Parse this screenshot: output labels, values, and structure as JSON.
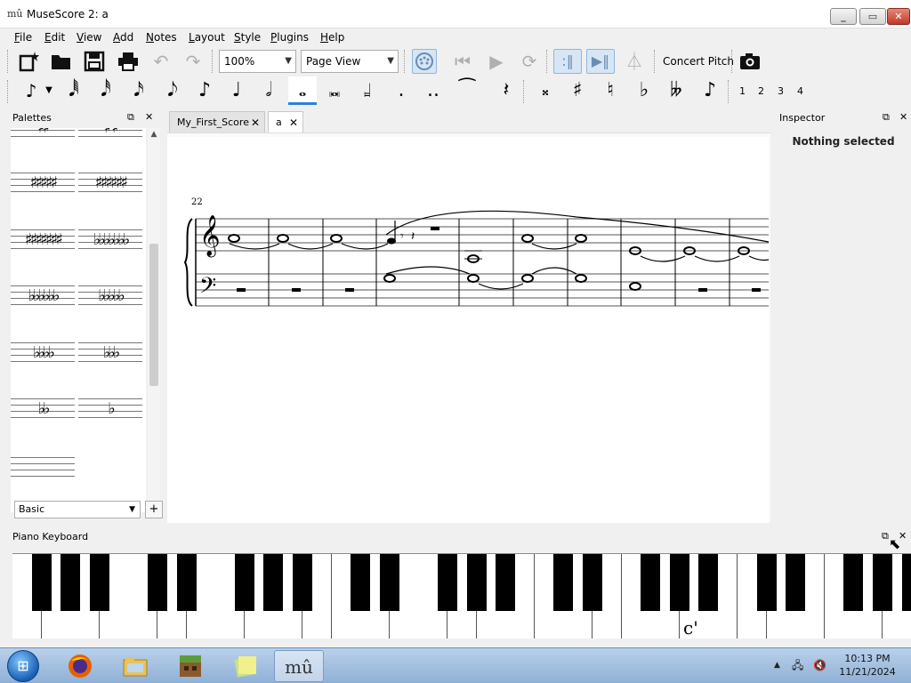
{
  "window": {
    "title": "MuseScore 2: a"
  },
  "menu": [
    "File",
    "Edit",
    "View",
    "Add",
    "Notes",
    "Layout",
    "Style",
    "Plugins",
    "Help"
  ],
  "toolbar": {
    "zoom": "100%",
    "view_mode": "Page View",
    "concert_pitch": "Concert Pitch"
  },
  "note_input": {
    "voices": [
      "1",
      "2",
      "3",
      "4"
    ]
  },
  "palettes": {
    "title": "Palettes",
    "workspace": "Basic",
    "add_label": "+"
  },
  "tabs": [
    {
      "label": "My_First_Score"
    },
    {
      "label": "a"
    }
  ],
  "score": {
    "measure_number": "22"
  },
  "inspector": {
    "title": "Inspector",
    "status": "Nothing selected"
  },
  "piano": {
    "title": "Piano Keyboard",
    "c_label": "c'"
  },
  "taskbar": {
    "time": "10:13 PM",
    "date": "11/21/2024"
  }
}
